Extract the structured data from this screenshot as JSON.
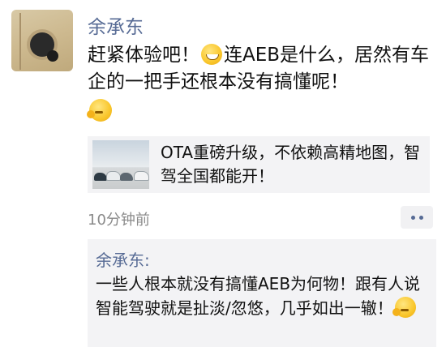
{
  "post": {
    "author": "余承东",
    "content_part1": "赶紧体验吧！",
    "content_part2": "连AEB是什么，居然有车企的一把手还根本没有搞懂呢！",
    "emoji_inline": "grinning-face",
    "emoji_trailing": "thinking-face",
    "link": {
      "title": "OTA重磅升级，不依赖高精地图，智驾全国都能开！",
      "thumbnail": "cars-lineup-image"
    },
    "time": "10分钟前"
  },
  "comment": {
    "author": "余承东:",
    "text": "一些人根本就没有搞懂AEB为何物！跟有人说智能驾驶就是扯淡/忽悠，几乎如出一辙！",
    "emoji": "thinking-face"
  },
  "colors": {
    "name": "#576b95",
    "card_bg": "#f3f3f5",
    "time": "#8a8a8a"
  }
}
